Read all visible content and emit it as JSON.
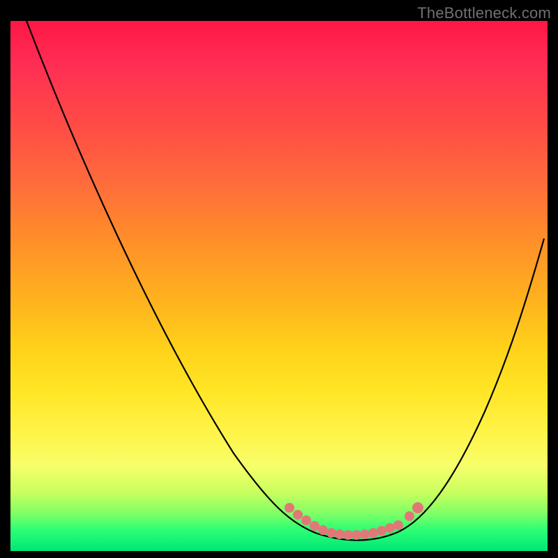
{
  "watermark": "TheBottleneck.com",
  "colors": {
    "frame": "#000000",
    "curve": "#000000",
    "marker": "#e57373",
    "gradient_top": "#ff1744",
    "gradient_bottom": "#00e676"
  },
  "chart_data": {
    "type": "line",
    "title": "",
    "xlabel": "",
    "ylabel": "",
    "xlim": [
      0,
      100
    ],
    "ylim": [
      0,
      100
    ],
    "note": "Y axis is inverted visually (0 at bottom = green/good, 100 at top = red/bad). Curve is a bottleneck-style V: steep drop from top-left to a flat minimum band then rise to right.",
    "series": [
      {
        "name": "bottleneck-curve",
        "x": [
          3,
          10,
          20,
          30,
          40,
          48,
          52,
          56,
          60,
          64,
          68,
          72,
          76,
          80,
          86,
          92,
          99
        ],
        "y": [
          100,
          84,
          67,
          50,
          34,
          20,
          12,
          6,
          3,
          2,
          2,
          3,
          6,
          12,
          26,
          45,
          72
        ]
      }
    ],
    "markers": {
      "name": "optimal-band",
      "x": [
        52,
        54,
        56,
        58,
        60,
        62,
        64,
        66,
        68,
        70,
        72,
        74,
        76
      ],
      "y": [
        8,
        6,
        4.5,
        3.5,
        3,
        2.5,
        2.3,
        2.3,
        2.5,
        3,
        3.8,
        5,
        7
      ]
    }
  }
}
